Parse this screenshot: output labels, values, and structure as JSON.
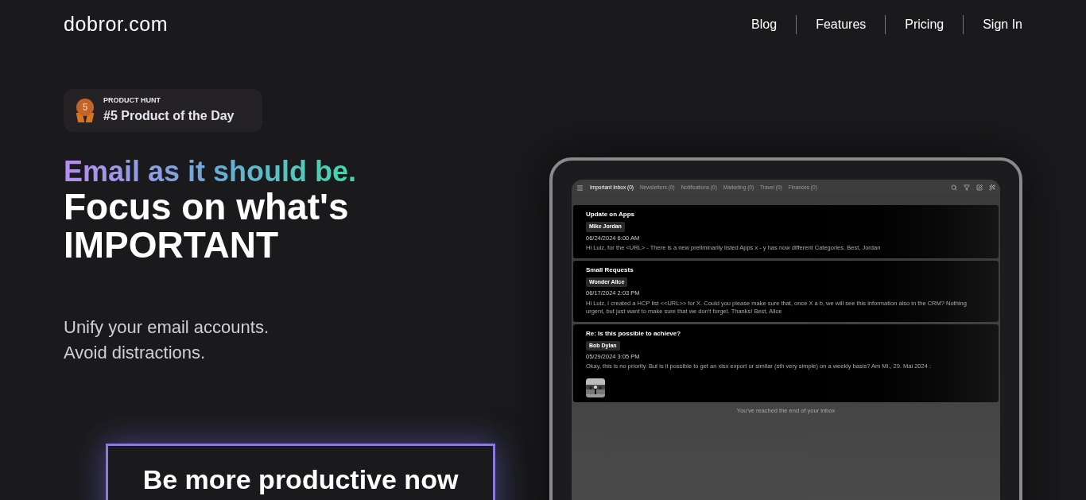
{
  "logo": "dobror.com",
  "nav": [
    {
      "label": "Blog"
    },
    {
      "label": "Features"
    },
    {
      "label": "Pricing"
    },
    {
      "label": "Sign In"
    }
  ],
  "badge": {
    "medal_number": "5",
    "kicker": "PRODUCT HUNT",
    "title": "#5 Product of the Day"
  },
  "hero": {
    "tagline": "Email as it should be.",
    "headline": "Focus on what's IMPORTANT",
    "subtext": [
      "Unify your email accounts.",
      "Avoid distractions."
    ],
    "cta": "Be more productive now"
  },
  "app": {
    "tabs": [
      {
        "label": "Important Inbox (0)",
        "selected": true
      },
      {
        "label": "Newsletters (0)",
        "selected": false
      },
      {
        "label": "Notifications (0)",
        "selected": false
      },
      {
        "label": "Marketing (0)",
        "selected": false
      },
      {
        "label": "Travel (0)",
        "selected": false
      },
      {
        "label": "Finances (0)",
        "selected": false
      }
    ],
    "emails": [
      {
        "subject": "Update on Apps",
        "sender": "Mike Jordan",
        "date": "06/24/2024 6:00 AM",
        "preview": "Hi Luiz, for the <URL> - There is a new preliminarily listed Apps x - y has now different Categories. Best, Jordan"
      },
      {
        "subject": "Small Requests",
        "sender": "Wonder Alice",
        "date": "06/17/2024 2:03 PM",
        "preview": "Hi Luiz, I created a HCP list <<URL>> for X. Could you please make sure that, once X a b, we will see this information also in the CRM? Nothing urgent, but just want to make sure that we don't forget. Thanks! Best, Alice"
      },
      {
        "subject": "Re: Is this possible to achieve?",
        "sender": "Bob Dylan",
        "date": "05/29/2024 3:05 PM",
        "preview": "Okay, this is no priority. But is it possible to get an xlsx export or similar (sth very simple) on a weekly basis? Am Mi., 29. Mai 2024 :"
      }
    ],
    "end_note": "You've reached the end of your inbox"
  }
}
